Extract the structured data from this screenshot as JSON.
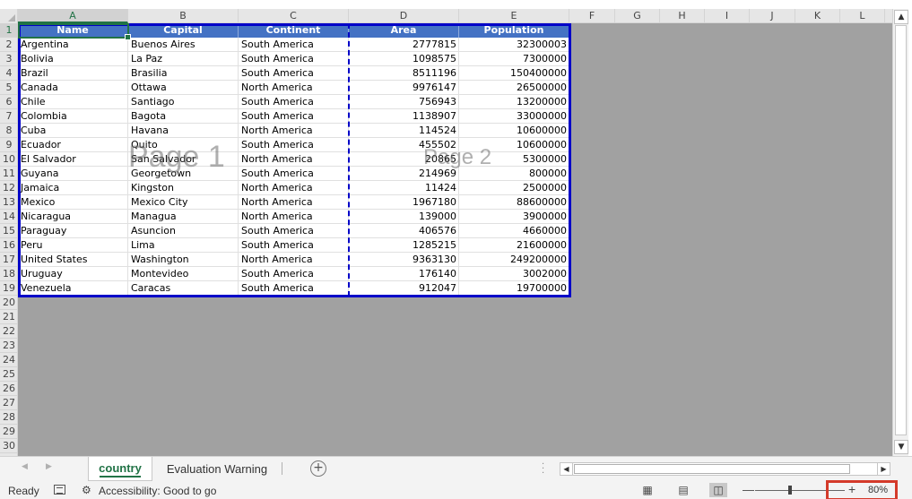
{
  "columns": [
    "A",
    "B",
    "C",
    "D",
    "E",
    "F",
    "G",
    "H",
    "I",
    "J",
    "K",
    "L"
  ],
  "rows": [
    "1",
    "2",
    "3",
    "4",
    "5",
    "6",
    "7",
    "8",
    "9",
    "10",
    "11",
    "12",
    "13",
    "14",
    "15",
    "16",
    "17",
    "18",
    "19",
    "20",
    "21",
    "22",
    "23",
    "24",
    "25",
    "26",
    "27",
    "28",
    "29",
    "30"
  ],
  "table": {
    "headers": [
      "Name",
      "Capital",
      "Continent",
      "Area",
      "Population"
    ],
    "rows": [
      [
        "Argentina",
        "Buenos Aires",
        "South America",
        "2777815",
        "32300003"
      ],
      [
        "Bolivia",
        "La Paz",
        "South America",
        "1098575",
        "7300000"
      ],
      [
        "Brazil",
        "Brasilia",
        "South America",
        "8511196",
        "150400000"
      ],
      [
        "Canada",
        "Ottawa",
        "North America",
        "9976147",
        "26500000"
      ],
      [
        "Chile",
        "Santiago",
        "South America",
        "756943",
        "13200000"
      ],
      [
        "Colombia",
        "Bagota",
        "South America",
        "1138907",
        "33000000"
      ],
      [
        "Cuba",
        "Havana",
        "North America",
        "114524",
        "10600000"
      ],
      [
        "Ecuador",
        "Quito",
        "South America",
        "455502",
        "10600000"
      ],
      [
        "El Salvador",
        "San Salvador",
        "North America",
        "20865",
        "5300000"
      ],
      [
        "Guyana",
        "Georgetown",
        "South America",
        "214969",
        "800000"
      ],
      [
        "Jamaica",
        "Kingston",
        "North America",
        "11424",
        "2500000"
      ],
      [
        "Mexico",
        "Mexico City",
        "North America",
        "1967180",
        "88600000"
      ],
      [
        "Nicaragua",
        "Managua",
        "North America",
        "139000",
        "3900000"
      ],
      [
        "Paraguay",
        "Asuncion",
        "South America",
        "406576",
        "4660000"
      ],
      [
        "Peru",
        "Lima",
        "South America",
        "1285215",
        "21600000"
      ],
      [
        "United States",
        "Washington",
        "North America",
        "9363130",
        "249200000"
      ],
      [
        "Uruguay",
        "Montevideo",
        "South America",
        "176140",
        "3002000"
      ],
      [
        "Venezuela",
        "Caracas",
        "South America",
        "912047",
        "19700000"
      ]
    ]
  },
  "watermarks": {
    "page1": "Page 1",
    "page2": "Page 2"
  },
  "sheet_tabs": {
    "active": "country",
    "other": "Evaluation Warning"
  },
  "status": {
    "ready": "Ready",
    "accessibility": "Accessibility: Good to go",
    "zoom": "80%"
  },
  "colors": {
    "header_fill": "#4472c4",
    "page_border": "#0000c8",
    "background_gray": "#a1a1a1",
    "excel_green": "#217346",
    "highlight_red": "#d43a2a"
  },
  "icons": [
    "macro-record-icon",
    "accessibility-icon",
    "normal-view-icon",
    "page-layout-icon",
    "page-break-preview-icon",
    "add-sheet-icon",
    "zoom-minus-icon",
    "zoom-plus-icon"
  ]
}
